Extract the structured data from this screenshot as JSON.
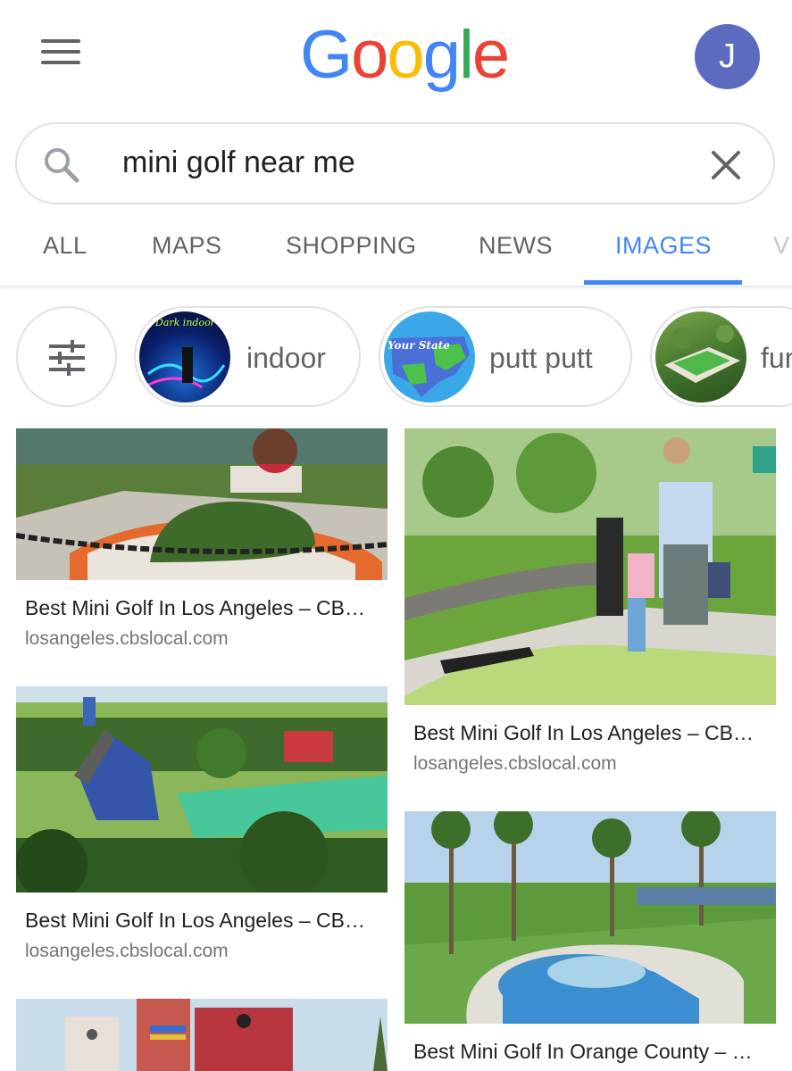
{
  "header": {
    "logo_letters": [
      {
        "ch": "G",
        "color": "#4285f4"
      },
      {
        "ch": "o",
        "color": "#ea4335"
      },
      {
        "ch": "o",
        "color": "#fbbc05"
      },
      {
        "ch": "g",
        "color": "#4285f4"
      },
      {
        "ch": "l",
        "color": "#34a853"
      },
      {
        "ch": "e",
        "color": "#ea4335"
      }
    ],
    "avatar_initial": "J",
    "avatar_color": "#5c6bc0"
  },
  "search": {
    "query": "mini golf near me",
    "icon": "search-icon",
    "clear_icon": "close-icon"
  },
  "tabs": [
    "ALL",
    "MAPS",
    "SHOPPING",
    "NEWS",
    "IMAGES",
    "V"
  ],
  "active_tab": "IMAGES",
  "accent_color": "#4285f4",
  "chips": [
    {
      "label": "indoor",
      "thumb_text": "Dark indoor mini"
    },
    {
      "label": "putt putt",
      "thumb_text": "Your State"
    },
    {
      "label": "fun"
    }
  ],
  "results": [
    {
      "title": "Best Mini Golf In Los Angeles – CB…",
      "source": "losangeles.cbslocal.com"
    },
    {
      "title": "Best Mini Golf In Los Angeles – CB…",
      "source": "losangeles.cbslocal.com"
    },
    {
      "title": "Best Mini Golf In Los Angeles – CB…",
      "source": "losangeles.cbslocal.com"
    },
    {
      "title": "Best Mini Golf In Orange County – …",
      "source": ""
    }
  ]
}
